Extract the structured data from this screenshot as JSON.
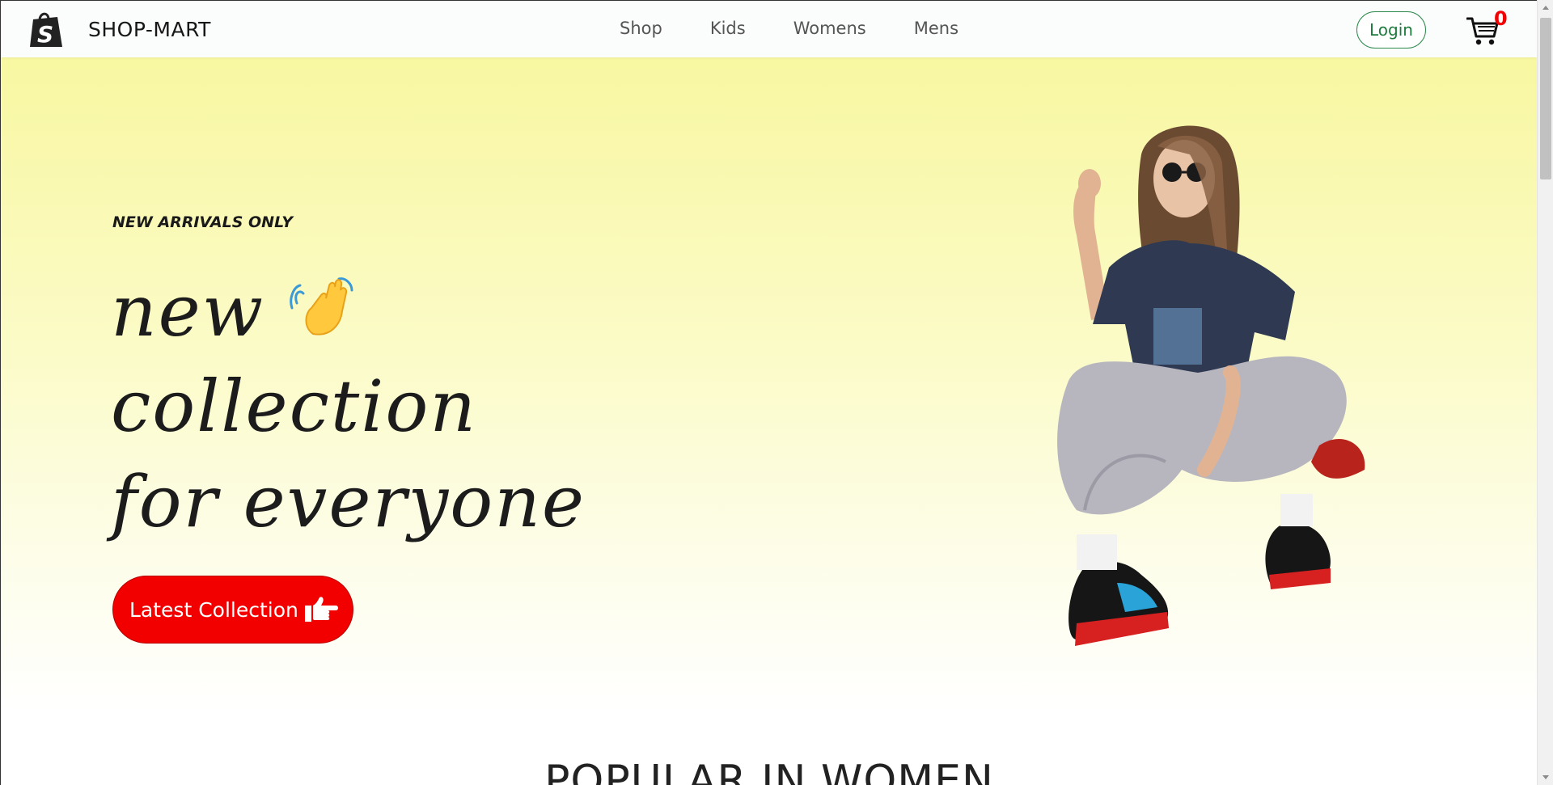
{
  "brand": {
    "name": "SHOP-MART",
    "logo_icon": "shopify-bag-icon",
    "accent": "#f20000"
  },
  "nav": {
    "items": [
      {
        "label": "Shop"
      },
      {
        "label": "Kids"
      },
      {
        "label": "Womens"
      },
      {
        "label": "Mens"
      }
    ]
  },
  "header": {
    "login_label": "Login",
    "cart_count": "0",
    "cart_icon": "shopping-cart-icon"
  },
  "hero": {
    "tag": "NEW ARRIVALS ONLY",
    "title_lines": [
      "new",
      "collection",
      "for everyone"
    ],
    "wave_icon": "waving-hand-icon",
    "cta_label": "Latest Collection",
    "cta_icon": "pointing-hand-icon",
    "background_top": "#f8f7a1",
    "background_bottom": "#ffffff"
  },
  "sections": {
    "popular_title": "POPULAR IN WOMEN"
  }
}
